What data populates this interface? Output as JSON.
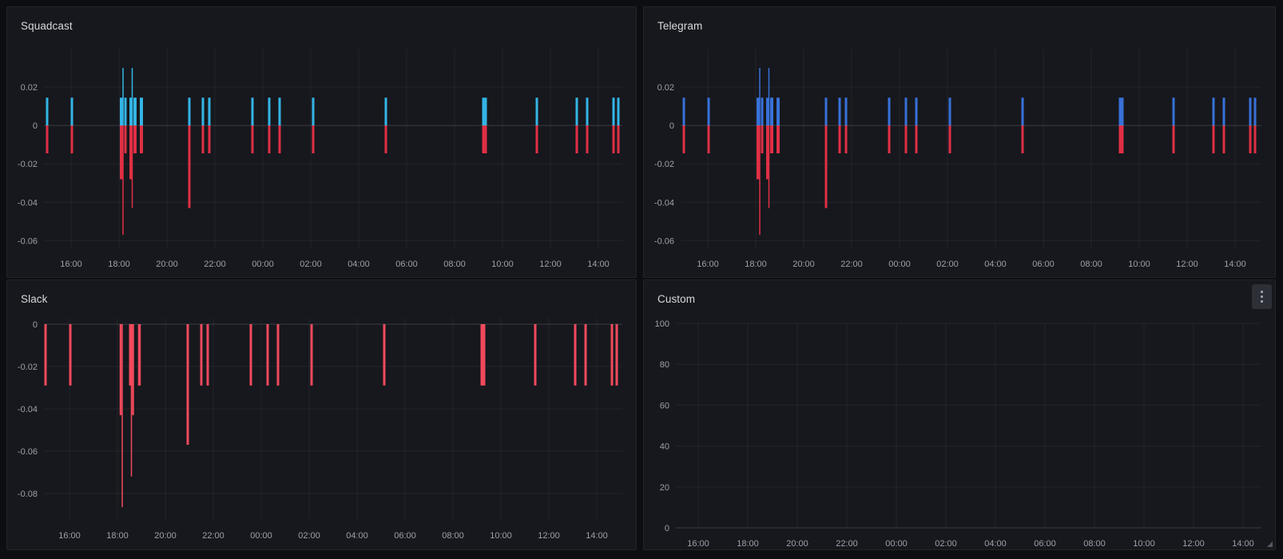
{
  "dashboard": {
    "panel_titles": [
      "Squadcast",
      "Telegram",
      "Slack",
      "Custom"
    ],
    "panel_menu": {
      "icon": "kebab-menu-icon"
    }
  },
  "chart_data": [
    {
      "type": "bar",
      "title": "Squadcast",
      "xlabel": "",
      "ylabel": "",
      "grid": true,
      "legend": "none",
      "x_ticks": [
        "16:00",
        "18:00",
        "20:00",
        "22:00",
        "00:00",
        "02:00",
        "04:00",
        "06:00",
        "08:00",
        "10:00",
        "12:00",
        "14:00"
      ],
      "y_ticks": [
        "0.02",
        "0",
        "-0.02",
        "-0.04",
        "-0.06"
      ],
      "y_tick_values": [
        0.02,
        0,
        -0.02,
        -0.04,
        -0.06
      ],
      "ylim": [
        -0.064,
        0.04
      ],
      "series": [
        {
          "name": "positive",
          "color": "#33b5e5",
          "bars": [
            {
              "t": "15:00",
              "v": 0.0145
            },
            {
              "t": "16:02",
              "v": 0.0145
            },
            {
              "t": "18:06",
              "v": 0.0145,
              "w": 4
            },
            {
              "t": "18:10",
              "v": 0.03,
              "w": 1.5
            },
            {
              "t": "18:16",
              "v": 0.0145,
              "w": 3
            },
            {
              "t": "18:30",
              "v": 0.0145,
              "w": 4
            },
            {
              "t": "18:33",
              "v": 0.03,
              "w": 1.5
            },
            {
              "t": "18:40",
              "v": 0.0145,
              "w": 4
            },
            {
              "t": "18:56",
              "v": 0.0145,
              "w": 4
            },
            {
              "t": "20:56",
              "v": 0.0145
            },
            {
              "t": "21:30",
              "v": 0.0145
            },
            {
              "t": "21:46",
              "v": 0.0145
            },
            {
              "t": "23:34",
              "v": 0.0145
            },
            {
              "t": "00:16",
              "v": 0.0145
            },
            {
              "t": "00:42",
              "v": 0.0145
            },
            {
              "t": "02:06",
              "v": 0.0145
            },
            {
              "t": "05:08",
              "v": 0.0145
            },
            {
              "t": "09:12",
              "v": 0.0145
            },
            {
              "t": "09:18",
              "v": 0.0145
            },
            {
              "t": "11:26",
              "v": 0.0145
            },
            {
              "t": "13:06",
              "v": 0.0145
            },
            {
              "t": "13:32",
              "v": 0.0145
            },
            {
              "t": "14:38",
              "v": 0.0145
            },
            {
              "t": "14:50",
              "v": 0.0145
            }
          ]
        },
        {
          "name": "negative",
          "color": "#e02f44",
          "bars": [
            {
              "t": "15:00",
              "v": -0.0145
            },
            {
              "t": "16:02",
              "v": -0.0145
            },
            {
              "t": "18:06",
              "v": -0.028,
              "w": 4
            },
            {
              "t": "18:10",
              "v": -0.057,
              "w": 1.5
            },
            {
              "t": "18:16",
              "v": -0.0145,
              "w": 3
            },
            {
              "t": "18:30",
              "v": -0.028,
              "w": 4
            },
            {
              "t": "18:33",
              "v": -0.043,
              "w": 1.5
            },
            {
              "t": "18:40",
              "v": -0.0145,
              "w": 4
            },
            {
              "t": "18:56",
              "v": -0.0145,
              "w": 4
            },
            {
              "t": "20:56",
              "v": -0.043
            },
            {
              "t": "21:30",
              "v": -0.0145
            },
            {
              "t": "21:46",
              "v": -0.0145
            },
            {
              "t": "23:34",
              "v": -0.0145
            },
            {
              "t": "00:16",
              "v": -0.0145
            },
            {
              "t": "00:42",
              "v": -0.0145
            },
            {
              "t": "02:06",
              "v": -0.0145
            },
            {
              "t": "05:08",
              "v": -0.0145
            },
            {
              "t": "09:12",
              "v": -0.0145
            },
            {
              "t": "09:18",
              "v": -0.0145
            },
            {
              "t": "11:26",
              "v": -0.0145
            },
            {
              "t": "13:06",
              "v": -0.0145
            },
            {
              "t": "13:32",
              "v": -0.0145
            },
            {
              "t": "14:38",
              "v": -0.0145
            },
            {
              "t": "14:50",
              "v": -0.0145
            }
          ]
        }
      ]
    },
    {
      "type": "bar",
      "title": "Telegram",
      "xlabel": "",
      "ylabel": "",
      "grid": true,
      "legend": "none",
      "x_ticks": [
        "16:00",
        "18:00",
        "20:00",
        "22:00",
        "00:00",
        "02:00",
        "04:00",
        "06:00",
        "08:00",
        "10:00",
        "12:00",
        "14:00"
      ],
      "y_ticks": [
        "0.02",
        "0",
        "-0.02",
        "-0.04",
        "-0.06"
      ],
      "y_tick_values": [
        0.02,
        0,
        -0.02,
        -0.04,
        -0.06
      ],
      "ylim": [
        -0.064,
        0.04
      ],
      "series": [
        {
          "name": "positive",
          "color": "#3871d9",
          "bars": [
            {
              "t": "15:00",
              "v": 0.0145
            },
            {
              "t": "16:02",
              "v": 0.0145
            },
            {
              "t": "18:06",
              "v": 0.0145,
              "w": 4
            },
            {
              "t": "18:10",
              "v": 0.03,
              "w": 1.5
            },
            {
              "t": "18:16",
              "v": 0.0145,
              "w": 3
            },
            {
              "t": "18:30",
              "v": 0.0145,
              "w": 4
            },
            {
              "t": "18:33",
              "v": 0.03,
              "w": 1.5
            },
            {
              "t": "18:40",
              "v": 0.0145,
              "w": 4
            },
            {
              "t": "18:56",
              "v": 0.0145,
              "w": 4
            },
            {
              "t": "20:56",
              "v": 0.0145
            },
            {
              "t": "21:30",
              "v": 0.0145
            },
            {
              "t": "21:46",
              "v": 0.0145
            },
            {
              "t": "23:34",
              "v": 0.0145
            },
            {
              "t": "00:16",
              "v": 0.0145
            },
            {
              "t": "00:42",
              "v": 0.0145
            },
            {
              "t": "02:06",
              "v": 0.0145
            },
            {
              "t": "05:08",
              "v": 0.0145
            },
            {
              "t": "09:12",
              "v": 0.0145
            },
            {
              "t": "09:18",
              "v": 0.0145
            },
            {
              "t": "11:26",
              "v": 0.0145
            },
            {
              "t": "13:06",
              "v": 0.0145
            },
            {
              "t": "13:32",
              "v": 0.0145
            },
            {
              "t": "14:38",
              "v": 0.0145
            },
            {
              "t": "14:50",
              "v": 0.0145
            }
          ]
        },
        {
          "name": "negative",
          "color": "#e02f44",
          "bars": [
            {
              "t": "15:00",
              "v": -0.0145
            },
            {
              "t": "16:02",
              "v": -0.0145
            },
            {
              "t": "18:06",
              "v": -0.028,
              "w": 4
            },
            {
              "t": "18:10",
              "v": -0.057,
              "w": 1.5
            },
            {
              "t": "18:16",
              "v": -0.0145,
              "w": 3
            },
            {
              "t": "18:30",
              "v": -0.028,
              "w": 4
            },
            {
              "t": "18:33",
              "v": -0.043,
              "w": 1.5
            },
            {
              "t": "18:40",
              "v": -0.0145,
              "w": 4
            },
            {
              "t": "18:56",
              "v": -0.0145,
              "w": 4
            },
            {
              "t": "20:56",
              "v": -0.043
            },
            {
              "t": "21:30",
              "v": -0.0145
            },
            {
              "t": "21:46",
              "v": -0.0145
            },
            {
              "t": "23:34",
              "v": -0.0145
            },
            {
              "t": "00:16",
              "v": -0.0145
            },
            {
              "t": "00:42",
              "v": -0.0145
            },
            {
              "t": "02:06",
              "v": -0.0145
            },
            {
              "t": "05:08",
              "v": -0.0145
            },
            {
              "t": "09:12",
              "v": -0.0145
            },
            {
              "t": "09:18",
              "v": -0.0145
            },
            {
              "t": "11:26",
              "v": -0.0145
            },
            {
              "t": "13:06",
              "v": -0.0145
            },
            {
              "t": "13:32",
              "v": -0.0145
            },
            {
              "t": "14:38",
              "v": -0.0145
            },
            {
              "t": "14:50",
              "v": -0.0145
            }
          ]
        }
      ]
    },
    {
      "type": "bar",
      "title": "Slack",
      "xlabel": "",
      "ylabel": "",
      "grid": true,
      "legend": "none",
      "x_ticks": [
        "16:00",
        "18:00",
        "20:00",
        "22:00",
        "00:00",
        "02:00",
        "04:00",
        "06:00",
        "08:00",
        "10:00",
        "12:00",
        "14:00"
      ],
      "y_ticks": [
        "0",
        "-0.02",
        "-0.04",
        "-0.06",
        "-0.08"
      ],
      "y_tick_values": [
        0,
        -0.02,
        -0.04,
        -0.06,
        -0.08
      ],
      "ylim": [
        -0.0925,
        0.003
      ],
      "series": [
        {
          "name": "negative",
          "color": "#f2495c",
          "bars": [
            {
              "t": "15:00",
              "v": -0.029
            },
            {
              "t": "16:02",
              "v": -0.029
            },
            {
              "t": "18:08",
              "v": -0.043,
              "w": 2.5
            },
            {
              "t": "18:12",
              "v": -0.0865,
              "w": 1.5
            },
            {
              "t": "18:33",
              "v": -0.029,
              "w": 4
            },
            {
              "t": "18:35",
              "v": -0.072,
              "w": 1.5
            },
            {
              "t": "18:39",
              "v": -0.043,
              "w": 2.5
            },
            {
              "t": "18:55",
              "v": -0.029,
              "w": 3.5
            },
            {
              "t": "20:56",
              "v": -0.057
            },
            {
              "t": "21:30",
              "v": -0.029
            },
            {
              "t": "21:46",
              "v": -0.029
            },
            {
              "t": "23:34",
              "v": -0.029
            },
            {
              "t": "00:16",
              "v": -0.029
            },
            {
              "t": "00:42",
              "v": -0.029
            },
            {
              "t": "02:06",
              "v": -0.029
            },
            {
              "t": "05:08",
              "v": -0.029
            },
            {
              "t": "09:12",
              "v": -0.029
            },
            {
              "t": "09:18",
              "v": -0.029
            },
            {
              "t": "11:26",
              "v": -0.029
            },
            {
              "t": "13:06",
              "v": -0.029
            },
            {
              "t": "13:32",
              "v": -0.029
            },
            {
              "t": "14:38",
              "v": -0.029
            },
            {
              "t": "14:50",
              "v": -0.029
            }
          ]
        }
      ]
    },
    {
      "type": "bar",
      "title": "Custom",
      "xlabel": "",
      "ylabel": "",
      "grid": true,
      "legend": "none",
      "x_ticks": [
        "16:00",
        "18:00",
        "20:00",
        "22:00",
        "00:00",
        "02:00",
        "04:00",
        "06:00",
        "08:00",
        "10:00",
        "12:00",
        "14:00"
      ],
      "y_ticks": [
        "100",
        "80",
        "60",
        "40",
        "20",
        "0"
      ],
      "y_tick_values": [
        100,
        80,
        60,
        40,
        20,
        0
      ],
      "ylim": [
        0,
        100
      ],
      "series": []
    }
  ]
}
